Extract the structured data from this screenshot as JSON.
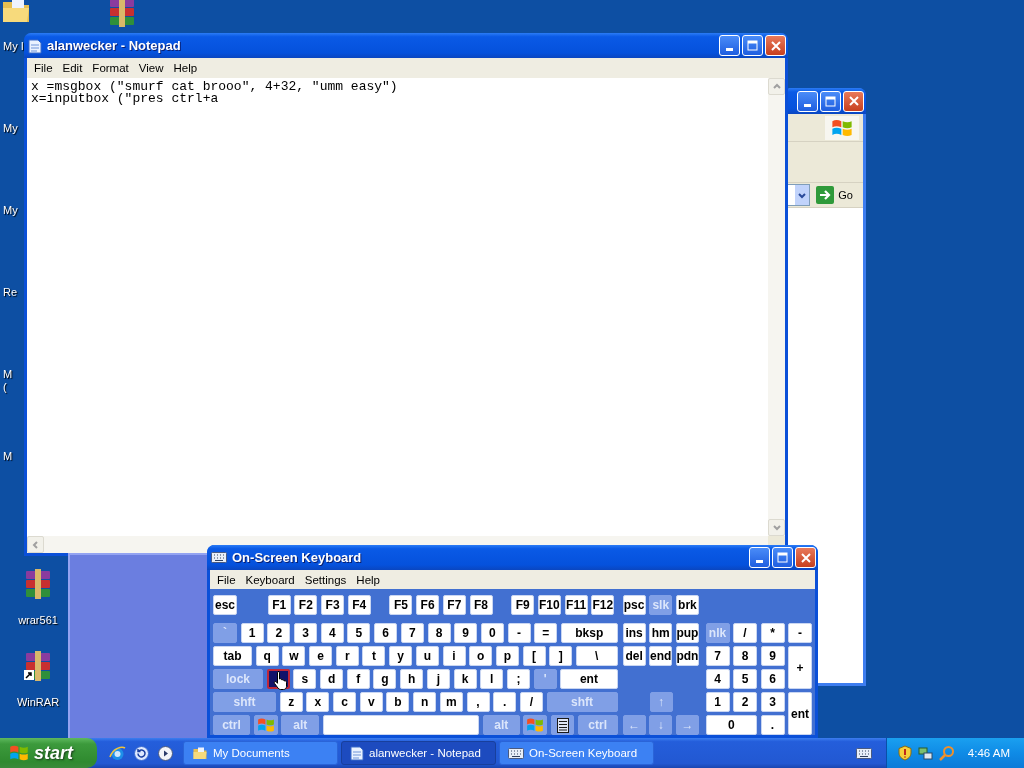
{
  "desktop_icons": [
    {
      "label": [
        "My I"
      ]
    },
    {
      "label": [
        "My"
      ]
    },
    {
      "label": [
        "My"
      ]
    },
    {
      "label": [
        "Re"
      ]
    },
    {
      "label": [
        "M",
        "("
      ]
    },
    {
      "label": [
        "M"
      ]
    },
    {
      "label": [
        "wrar561"
      ]
    },
    {
      "label": [
        "WinRAR"
      ]
    }
  ],
  "background_window": {
    "go_button": "Go"
  },
  "notepad": {
    "title": "alanwecker - Notepad",
    "menu": [
      "File",
      "Edit",
      "Format",
      "View",
      "Help"
    ],
    "lines": [
      "x =msgbox (\"smurf cat brooo\", 4+32, \"umm easy\")",
      "x=inputbox (\"pres ctrl+a"
    ]
  },
  "keyboard": {
    "title": "On-Screen Keyboard",
    "menu": [
      "File",
      "Keyboard",
      "Settings",
      "Help"
    ],
    "main_rows": [
      [
        {
          "label": "esc",
          "kind": "key"
        },
        {
          "label": "F1",
          "kind": "key"
        },
        {
          "label": "F2",
          "kind": "key"
        },
        {
          "label": "F3",
          "kind": "key"
        },
        {
          "label": "F4",
          "kind": "key"
        },
        {
          "label": "F5",
          "kind": "key"
        },
        {
          "label": "F6",
          "kind": "key"
        },
        {
          "label": "F7",
          "kind": "key"
        },
        {
          "label": "F8",
          "kind": "key"
        },
        {
          "label": "F9",
          "kind": "key"
        },
        {
          "label": "F10",
          "kind": "key"
        },
        {
          "label": "F11",
          "kind": "key"
        },
        {
          "label": "F12",
          "kind": "key"
        }
      ],
      [
        {
          "label": "`",
          "kind": "dim"
        },
        {
          "label": "1",
          "kind": "key"
        },
        {
          "label": "2",
          "kind": "key"
        },
        {
          "label": "3",
          "kind": "key"
        },
        {
          "label": "4",
          "kind": "key"
        },
        {
          "label": "5",
          "kind": "key"
        },
        {
          "label": "6",
          "kind": "key"
        },
        {
          "label": "7",
          "kind": "key"
        },
        {
          "label": "8",
          "kind": "key"
        },
        {
          "label": "9",
          "kind": "key"
        },
        {
          "label": "0",
          "kind": "key"
        },
        {
          "label": "-",
          "kind": "key"
        },
        {
          "label": "=",
          "kind": "key"
        },
        {
          "label": "bksp",
          "kind": "key"
        }
      ],
      [
        {
          "label": "tab",
          "kind": "key"
        },
        {
          "label": "q",
          "kind": "key"
        },
        {
          "label": "w",
          "kind": "key"
        },
        {
          "label": "e",
          "kind": "key"
        },
        {
          "label": "r",
          "kind": "key"
        },
        {
          "label": "t",
          "kind": "key"
        },
        {
          "label": "y",
          "kind": "key"
        },
        {
          "label": "u",
          "kind": "key"
        },
        {
          "label": "i",
          "kind": "key"
        },
        {
          "label": "o",
          "kind": "key"
        },
        {
          "label": "p",
          "kind": "key"
        },
        {
          "label": "[",
          "kind": "key"
        },
        {
          "label": "]",
          "kind": "key"
        },
        {
          "label": "\\",
          "kind": "key"
        }
      ],
      [
        {
          "label": "lock",
          "kind": "dim"
        },
        {
          "kind": "pressed"
        },
        {
          "label": "s",
          "kind": "key"
        },
        {
          "label": "d",
          "kind": "key"
        },
        {
          "label": "f",
          "kind": "key"
        },
        {
          "label": "g",
          "kind": "key"
        },
        {
          "label": "h",
          "kind": "key"
        },
        {
          "label": "j",
          "kind": "key"
        },
        {
          "label": "k",
          "kind": "key"
        },
        {
          "label": "l",
          "kind": "key"
        },
        {
          "label": ";",
          "kind": "key"
        },
        {
          "label": "'",
          "kind": "dim"
        },
        {
          "label": "ent",
          "kind": "key"
        }
      ],
      [
        {
          "label": "shft",
          "kind": "dim"
        },
        {
          "label": "z",
          "kind": "key"
        },
        {
          "label": "x",
          "kind": "key"
        },
        {
          "label": "c",
          "kind": "key"
        },
        {
          "label": "v",
          "kind": "key"
        },
        {
          "label": "b",
          "kind": "key"
        },
        {
          "label": "n",
          "kind": "key"
        },
        {
          "label": "m",
          "kind": "key"
        },
        {
          "label": ",",
          "kind": "key"
        },
        {
          "label": ".",
          "kind": "key"
        },
        {
          "label": "/",
          "kind": "key"
        },
        {
          "label": "shft",
          "kind": "dim"
        }
      ],
      [
        {
          "label": "ctrl",
          "kind": "dim"
        },
        {
          "kind": "logo"
        },
        {
          "label": "alt",
          "kind": "dim"
        },
        {
          "kind": "space"
        },
        {
          "label": "alt",
          "kind": "dim"
        },
        {
          "kind": "logo"
        },
        {
          "kind": "menu"
        },
        {
          "label": "ctrl",
          "kind": "dim"
        }
      ]
    ],
    "nav_keys": [
      {
        "label": "psc",
        "kind": "key"
      },
      {
        "label": "slk",
        "kind": "dim"
      },
      {
        "label": "brk",
        "kind": "key"
      },
      {
        "label": "ins",
        "kind": "key"
      },
      {
        "label": "hm",
        "kind": "key"
      },
      {
        "label": "pup",
        "kind": "key"
      },
      {
        "label": "del",
        "kind": "key"
      },
      {
        "label": "end",
        "kind": "key"
      },
      {
        "label": "pdn",
        "kind": "key"
      },
      {
        "label": "↑",
        "kind": "dim"
      },
      {
        "label": "←",
        "kind": "dim"
      },
      {
        "label": "↓",
        "kind": "dim"
      },
      {
        "label": "→",
        "kind": "dim"
      }
    ],
    "numpad_keys": [
      {
        "label": "nlk",
        "kind": "dim"
      },
      {
        "label": "/",
        "kind": "key"
      },
      {
        "label": "*",
        "kind": "key"
      },
      {
        "label": "-",
        "kind": "key"
      },
      {
        "label": "7",
        "kind": "key"
      },
      {
        "label": "8",
        "kind": "key"
      },
      {
        "label": "9",
        "kind": "key"
      },
      {
        "label": "+",
        "kind": "key"
      },
      {
        "label": "4",
        "kind": "key"
      },
      {
        "label": "5",
        "kind": "key"
      },
      {
        "label": "6",
        "kind": "key"
      },
      {
        "label": "1",
        "kind": "key"
      },
      {
        "label": "2",
        "kind": "key"
      },
      {
        "label": "3",
        "kind": "key"
      },
      {
        "label": "ent",
        "kind": "key"
      },
      {
        "label": "0",
        "kind": "key"
      },
      {
        "label": ".",
        "kind": "key"
      }
    ]
  },
  "taskbar": {
    "start": "start",
    "tasks": [
      {
        "label": "My Documents",
        "selected": false
      },
      {
        "label": "alanwecker - Notepad",
        "selected": true
      },
      {
        "label": "On-Screen Keyboard",
        "selected": false
      }
    ],
    "clock": "4:46 AM"
  }
}
